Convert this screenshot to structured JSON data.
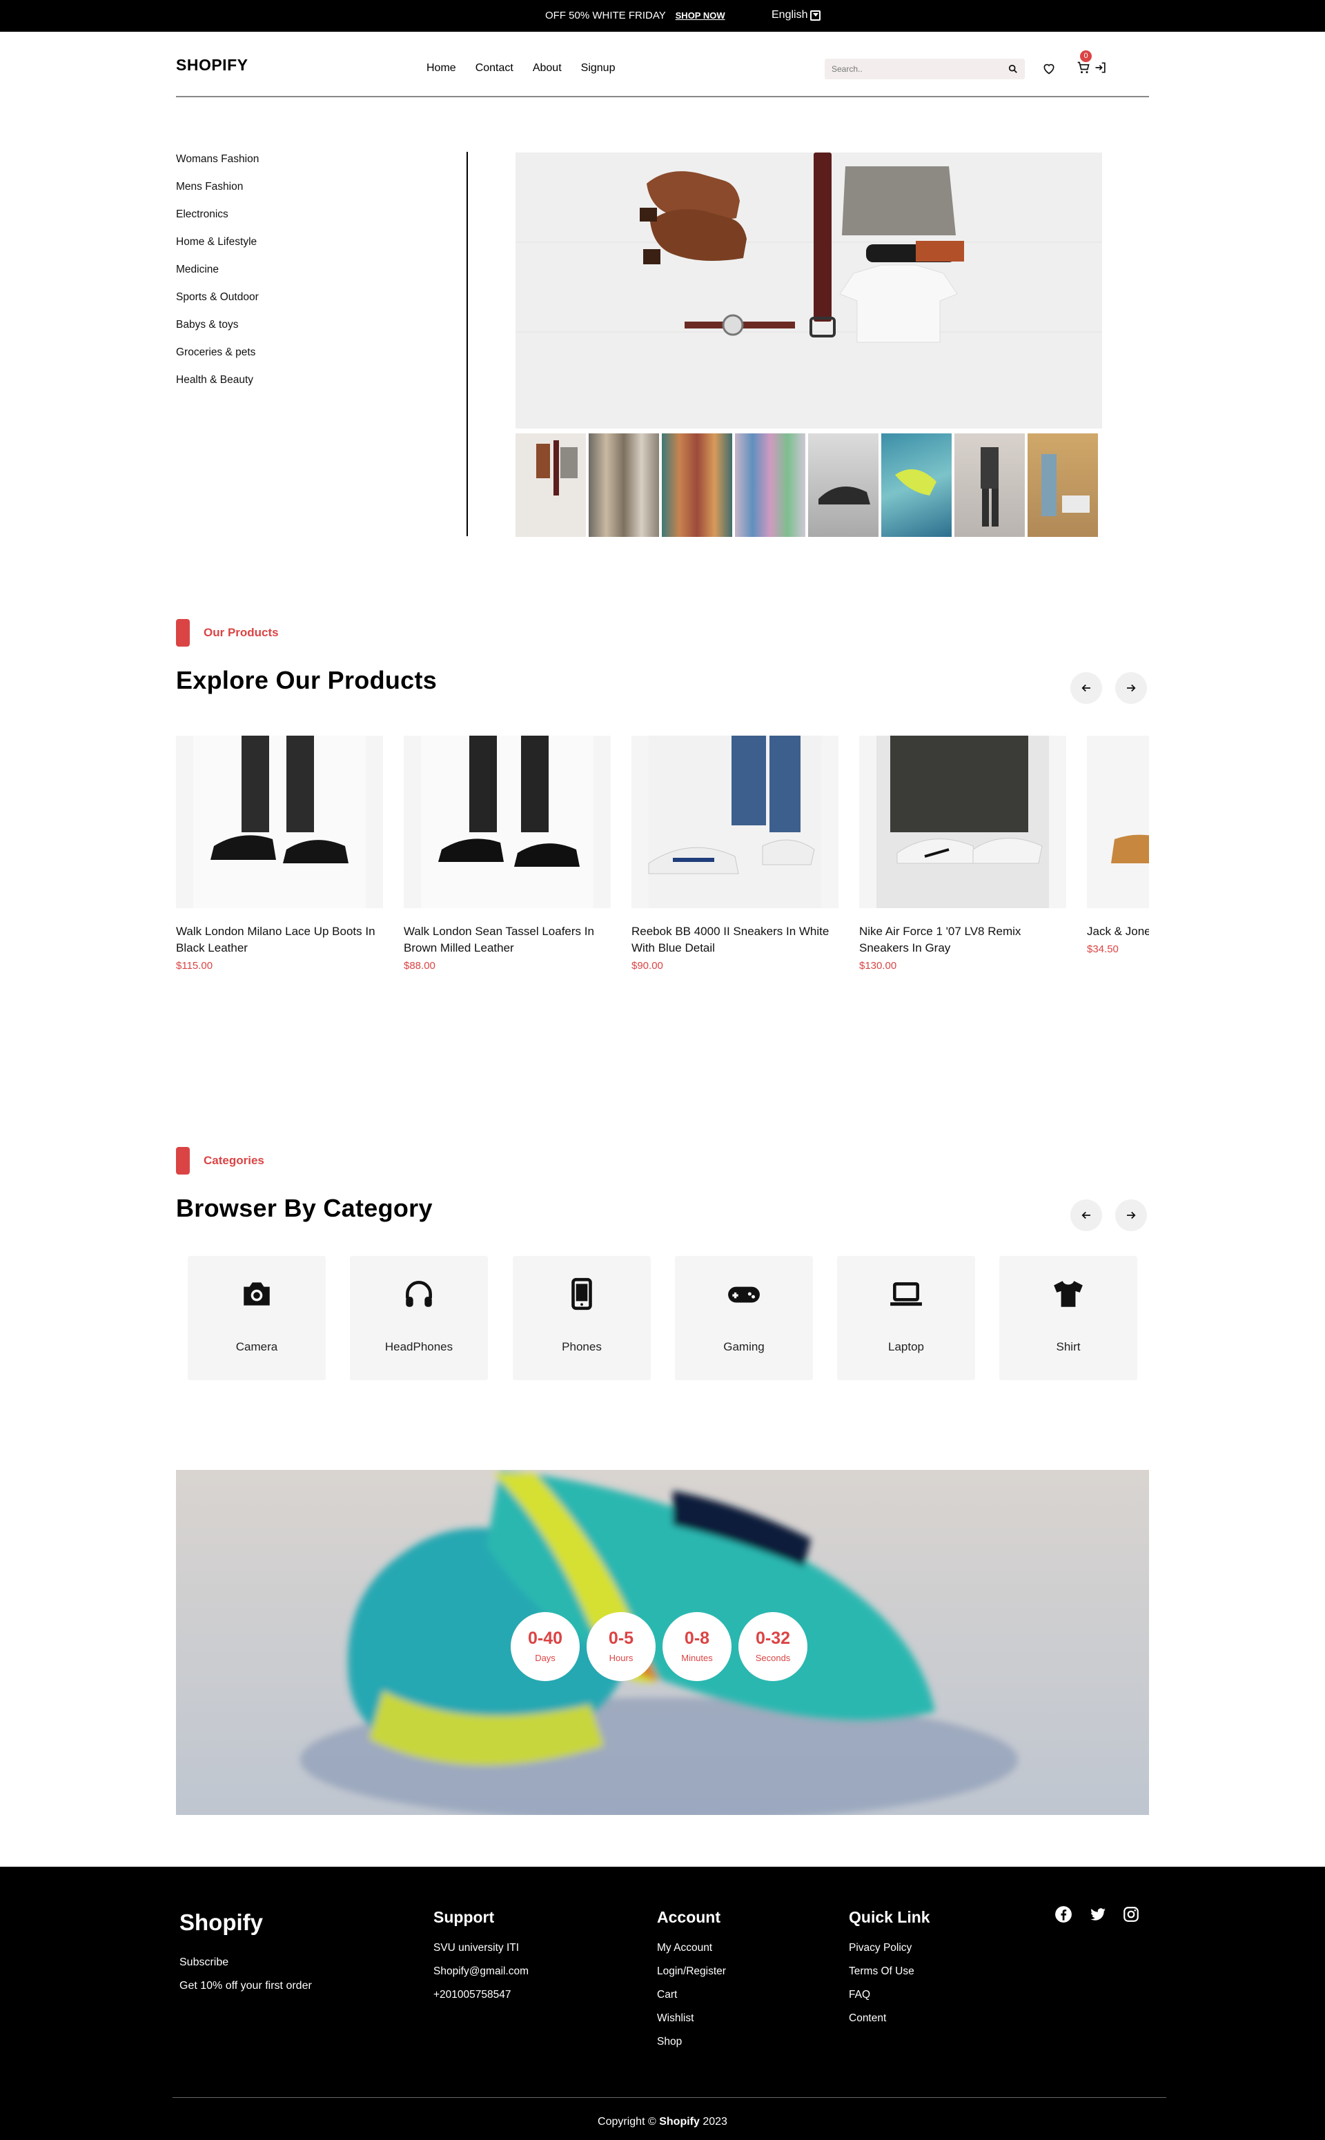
{
  "topbar": {
    "promo_text": "OFF 50% WHITE FRIDAY",
    "promo_link": "SHOP NOW",
    "language": "English"
  },
  "header": {
    "logo": "SHOPIFY",
    "nav": [
      "Home",
      "Contact",
      "About",
      "Signup"
    ],
    "search_placeholder": "Search..",
    "cart_count": "0"
  },
  "sidebar": {
    "items": [
      "Womans Fashion",
      "Mens Fashion",
      "Electronics",
      "Home & Lifestyle",
      "Medicine",
      "Sports & Outdoor",
      "Babys & toys",
      "Groceries & pets",
      "Health & Beauty"
    ]
  },
  "products_section": {
    "tag": "Our Products",
    "title": "Explore Our Products",
    "items": [
      {
        "name": "Walk London Milano Lace Up Boots In Black Leather",
        "price": "$115.00"
      },
      {
        "name": "Walk London Sean Tassel Loafers In Brown Milled Leather",
        "price": "$88.00"
      },
      {
        "name": "Reebok BB 4000 II Sneakers In White With Blue Detail",
        "price": "$90.00"
      },
      {
        "name": "Nike Air Force 1 '07 LV8 Remix Sneakers In Gray",
        "price": "$130.00"
      },
      {
        "name": "Jack & Jones Suede Slippers In Tan",
        "price": "$34.50"
      }
    ]
  },
  "categories_section": {
    "tag": "Categories",
    "title": "Browser By Category",
    "items": [
      {
        "label": "Camera",
        "icon": "camera-icon"
      },
      {
        "label": "HeadPhones",
        "icon": "headphones-icon"
      },
      {
        "label": "Phones",
        "icon": "phone-icon"
      },
      {
        "label": "Gaming",
        "icon": "gamepad-icon"
      },
      {
        "label": "Laptop",
        "icon": "laptop-icon"
      },
      {
        "label": "Shirt",
        "icon": "shirt-icon"
      }
    ]
  },
  "countdown": {
    "items": [
      {
        "value": "0-40",
        "label": "Days"
      },
      {
        "value": "0-5",
        "label": "Hours"
      },
      {
        "value": "0-8",
        "label": "Minutes"
      },
      {
        "value": "0-32",
        "label": "Seconds"
      }
    ]
  },
  "footer": {
    "brand": "Shopify",
    "subscribe": "Subscribe",
    "offer": "Get 10% off your first order",
    "support": {
      "title": "Support",
      "items": [
        "SVU university ITI",
        "Shopify@gmail.com",
        "+201005758547"
      ]
    },
    "account": {
      "title": "Account",
      "items": [
        "My Account",
        "Login/Register",
        "Cart",
        "Wishlist",
        "Shop"
      ]
    },
    "quick": {
      "title": "Quick Link",
      "items": [
        "Pivacy Policy",
        "Terms Of Use",
        "FAQ",
        "Content"
      ]
    },
    "copyright_prefix": "Copyright ©",
    "copyright_brand": "Shopify",
    "copyright_year": "2023"
  },
  "colors": {
    "accent": "#db4444",
    "footer_bg": "#000000",
    "card_bg": "#f5f5f5"
  }
}
